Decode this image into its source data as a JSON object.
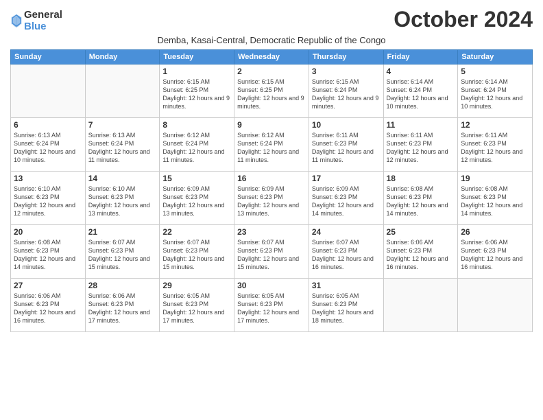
{
  "logo": {
    "general": "General",
    "blue": "Blue"
  },
  "title": "October 2024",
  "subtitle": "Demba, Kasai-Central, Democratic Republic of the Congo",
  "weekdays": [
    "Sunday",
    "Monday",
    "Tuesday",
    "Wednesday",
    "Thursday",
    "Friday",
    "Saturday"
  ],
  "weeks": [
    [
      {
        "day": "",
        "info": ""
      },
      {
        "day": "",
        "info": ""
      },
      {
        "day": "1",
        "info": "Sunrise: 6:15 AM\nSunset: 6:25 PM\nDaylight: 12 hours and 9 minutes."
      },
      {
        "day": "2",
        "info": "Sunrise: 6:15 AM\nSunset: 6:25 PM\nDaylight: 12 hours and 9 minutes."
      },
      {
        "day": "3",
        "info": "Sunrise: 6:15 AM\nSunset: 6:24 PM\nDaylight: 12 hours and 9 minutes."
      },
      {
        "day": "4",
        "info": "Sunrise: 6:14 AM\nSunset: 6:24 PM\nDaylight: 12 hours and 10 minutes."
      },
      {
        "day": "5",
        "info": "Sunrise: 6:14 AM\nSunset: 6:24 PM\nDaylight: 12 hours and 10 minutes."
      }
    ],
    [
      {
        "day": "6",
        "info": "Sunrise: 6:13 AM\nSunset: 6:24 PM\nDaylight: 12 hours and 10 minutes."
      },
      {
        "day": "7",
        "info": "Sunrise: 6:13 AM\nSunset: 6:24 PM\nDaylight: 12 hours and 11 minutes."
      },
      {
        "day": "8",
        "info": "Sunrise: 6:12 AM\nSunset: 6:24 PM\nDaylight: 12 hours and 11 minutes."
      },
      {
        "day": "9",
        "info": "Sunrise: 6:12 AM\nSunset: 6:24 PM\nDaylight: 12 hours and 11 minutes."
      },
      {
        "day": "10",
        "info": "Sunrise: 6:11 AM\nSunset: 6:23 PM\nDaylight: 12 hours and 11 minutes."
      },
      {
        "day": "11",
        "info": "Sunrise: 6:11 AM\nSunset: 6:23 PM\nDaylight: 12 hours and 12 minutes."
      },
      {
        "day": "12",
        "info": "Sunrise: 6:11 AM\nSunset: 6:23 PM\nDaylight: 12 hours and 12 minutes."
      }
    ],
    [
      {
        "day": "13",
        "info": "Sunrise: 6:10 AM\nSunset: 6:23 PM\nDaylight: 12 hours and 12 minutes."
      },
      {
        "day": "14",
        "info": "Sunrise: 6:10 AM\nSunset: 6:23 PM\nDaylight: 12 hours and 13 minutes."
      },
      {
        "day": "15",
        "info": "Sunrise: 6:09 AM\nSunset: 6:23 PM\nDaylight: 12 hours and 13 minutes."
      },
      {
        "day": "16",
        "info": "Sunrise: 6:09 AM\nSunset: 6:23 PM\nDaylight: 12 hours and 13 minutes."
      },
      {
        "day": "17",
        "info": "Sunrise: 6:09 AM\nSunset: 6:23 PM\nDaylight: 12 hours and 14 minutes."
      },
      {
        "day": "18",
        "info": "Sunrise: 6:08 AM\nSunset: 6:23 PM\nDaylight: 12 hours and 14 minutes."
      },
      {
        "day": "19",
        "info": "Sunrise: 6:08 AM\nSunset: 6:23 PM\nDaylight: 12 hours and 14 minutes."
      }
    ],
    [
      {
        "day": "20",
        "info": "Sunrise: 6:08 AM\nSunset: 6:23 PM\nDaylight: 12 hours and 14 minutes."
      },
      {
        "day": "21",
        "info": "Sunrise: 6:07 AM\nSunset: 6:23 PM\nDaylight: 12 hours and 15 minutes."
      },
      {
        "day": "22",
        "info": "Sunrise: 6:07 AM\nSunset: 6:23 PM\nDaylight: 12 hours and 15 minutes."
      },
      {
        "day": "23",
        "info": "Sunrise: 6:07 AM\nSunset: 6:23 PM\nDaylight: 12 hours and 15 minutes."
      },
      {
        "day": "24",
        "info": "Sunrise: 6:07 AM\nSunset: 6:23 PM\nDaylight: 12 hours and 16 minutes."
      },
      {
        "day": "25",
        "info": "Sunrise: 6:06 AM\nSunset: 6:23 PM\nDaylight: 12 hours and 16 minutes."
      },
      {
        "day": "26",
        "info": "Sunrise: 6:06 AM\nSunset: 6:23 PM\nDaylight: 12 hours and 16 minutes."
      }
    ],
    [
      {
        "day": "27",
        "info": "Sunrise: 6:06 AM\nSunset: 6:23 PM\nDaylight: 12 hours and 16 minutes."
      },
      {
        "day": "28",
        "info": "Sunrise: 6:06 AM\nSunset: 6:23 PM\nDaylight: 12 hours and 17 minutes."
      },
      {
        "day": "29",
        "info": "Sunrise: 6:05 AM\nSunset: 6:23 PM\nDaylight: 12 hours and 17 minutes."
      },
      {
        "day": "30",
        "info": "Sunrise: 6:05 AM\nSunset: 6:23 PM\nDaylight: 12 hours and 17 minutes."
      },
      {
        "day": "31",
        "info": "Sunrise: 6:05 AM\nSunset: 6:23 PM\nDaylight: 12 hours and 18 minutes."
      },
      {
        "day": "",
        "info": ""
      },
      {
        "day": "",
        "info": ""
      }
    ]
  ]
}
